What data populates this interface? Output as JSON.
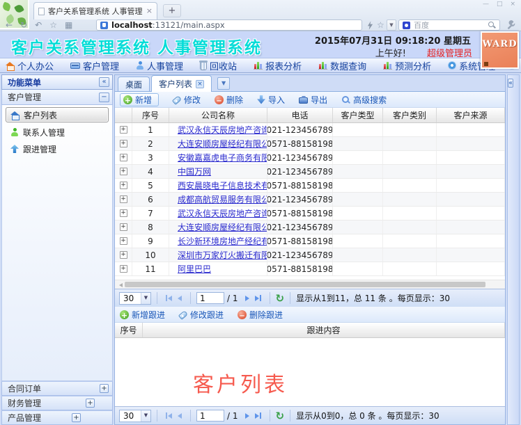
{
  "browser": {
    "tab_title": "客户关系管理系统 人事管理系",
    "new_tab_label": "+",
    "url_host": "localhost",
    "url_rest": ":13121/main.aspx",
    "search_placeholder": "百度"
  },
  "header": {
    "title": "客户关系管理系统 人事管理系统",
    "datetime": "2015年07月31日  09:18:20 星期五",
    "greeting": "上午好!",
    "user_role": "超级管理员",
    "avatar_text": "WARD"
  },
  "menubar": {
    "items": [
      {
        "label": "个人办公",
        "icon": "home-icon"
      },
      {
        "label": "客户管理",
        "icon": "card-icon"
      },
      {
        "label": "人事管理",
        "icon": "person-icon"
      },
      {
        "label": "回收站",
        "icon": "recycle-bin-icon"
      },
      {
        "label": "报表分析",
        "icon": "chart-icon"
      },
      {
        "label": "数据查询",
        "icon": "chart-icon"
      },
      {
        "label": "预测分析",
        "icon": "chart-icon"
      },
      {
        "label": "系统管理",
        "icon": "gear-icon"
      }
    ],
    "extra_icons": [
      "gear-icon",
      "help-icon",
      "plugin-icon",
      "forward-icon"
    ]
  },
  "sidebar": {
    "title": "功能菜单",
    "collapse_label": "«",
    "top_section": "客户管理",
    "top_section_toggle": "−",
    "nav_items": [
      {
        "label": "客户列表",
        "icon": "home-icon",
        "selected": true
      },
      {
        "label": "联系人管理",
        "icon": "person-icon",
        "selected": false
      },
      {
        "label": "跟进管理",
        "icon": "up-arrow-icon",
        "selected": false
      }
    ],
    "bottom_sections": [
      "合同订单",
      "财务管理",
      "产品管理"
    ],
    "expand_label": "+"
  },
  "tabs": {
    "desktop": "桌面",
    "customer_list": "客户列表",
    "dropdown": "▼"
  },
  "toolbar": [
    {
      "label": "新增",
      "icon": "add-icon",
      "highlighted": true
    },
    {
      "label": "修改",
      "icon": "edit-icon",
      "highlighted": false
    },
    {
      "label": "删除",
      "icon": "remove-icon",
      "highlighted": false
    },
    {
      "label": "导入",
      "icon": "import-icon",
      "highlighted": false
    },
    {
      "label": "导出",
      "icon": "export-icon",
      "highlighted": false
    },
    {
      "label": "高级搜索",
      "icon": "search-icon",
      "highlighted": false
    }
  ],
  "customer_grid": {
    "headers": [
      "序号",
      "公司名称",
      "电话",
      "客户类型",
      "客户类别",
      "客户来源"
    ],
    "rows": [
      {
        "no": "1",
        "company": "武汉永信天辰房地产咨询有限公司",
        "phone": "021-123456789"
      },
      {
        "no": "2",
        "company": "大连安顺房屋经纪有限公司",
        "phone": "0571-88158198"
      },
      {
        "no": "3",
        "company": "安徽嘉嘉虎电子商务有限公司",
        "phone": "021-123456789"
      },
      {
        "no": "4",
        "company": "中国万网",
        "phone": "021-123456789"
      },
      {
        "no": "5",
        "company": "西安晨晓电子信息技术有限公司",
        "phone": "0571-88158198"
      },
      {
        "no": "6",
        "company": "成都高航贸易服务有限公司",
        "phone": "021-123456789"
      },
      {
        "no": "7",
        "company": "武汉永信天辰房地产咨询有限公司",
        "phone": "0571-88158198"
      },
      {
        "no": "8",
        "company": "大连安顺房屋经纪有限公司",
        "phone": "021-123456789"
      },
      {
        "no": "9",
        "company": "长沙新环境房地产经纪有限公司",
        "phone": "0571-88158198"
      },
      {
        "no": "10",
        "company": "深圳市万家灯火搬迁有限公司",
        "phone": "021-123456789"
      },
      {
        "no": "11",
        "company": "阿里巴巴",
        "phone": "0571-88158198"
      }
    ]
  },
  "pager_top": {
    "page_size": "30",
    "page": "1",
    "total": "/ 1",
    "info": "显示从1到11，总 11 条 。每页显示：30"
  },
  "follow_toolbar": [
    {
      "label": "新增跟进",
      "icon": "add-icon",
      "highlighted": false
    },
    {
      "label": "修改跟进",
      "icon": "edit-icon",
      "highlighted": false
    },
    {
      "label": "删除跟进",
      "icon": "remove-icon",
      "highlighted": false
    }
  ],
  "follow_grid": {
    "headers": [
      "序号",
      "跟进内容"
    ],
    "watermark": "客户列表"
  },
  "pager_bottom": {
    "page_size": "30",
    "page": "1",
    "total": "/ 1",
    "info": "显示从0到0，总 0 条 。每页显示：30"
  }
}
